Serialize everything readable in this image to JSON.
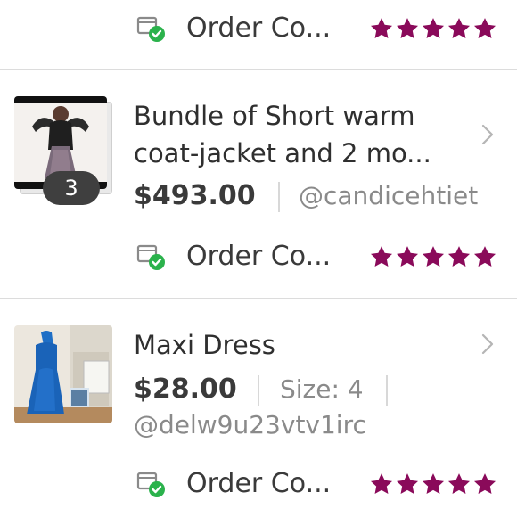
{
  "colors": {
    "star": "#8a0a5a",
    "check": "#2bb24c",
    "divider": "#dcdcdc",
    "text_primary": "#2f2f2f",
    "text_secondary": "#8a8a8a"
  },
  "orders": [
    {
      "status_icon": "order-complete-icon",
      "status_label": "Order Co...",
      "rating": 5
    },
    {
      "title_line1": "Bundle of Short  warm",
      "title_line2": "coat-jacket and 2 mo...",
      "price": "$493.00",
      "seller": "@candicehtiet",
      "item_count": "3",
      "status_icon": "order-complete-icon",
      "status_label": "Order Co...",
      "rating": 5
    },
    {
      "title_line1": "Maxi Dress",
      "price": "$28.00",
      "size": "Size: 4",
      "seller": "@delw9u23vtv1irc",
      "status_icon": "order-complete-icon",
      "status_label": "Order Co...",
      "rating": 5
    }
  ]
}
